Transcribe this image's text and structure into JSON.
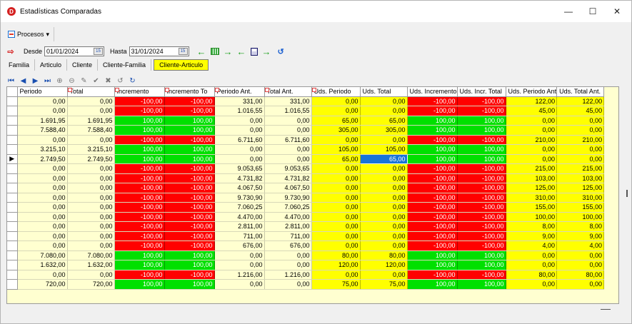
{
  "window": {
    "title": "Estadísticas Comparadas",
    "app_icon": "D",
    "min": "—",
    "max": "☐",
    "close": "✕"
  },
  "toolbar": {
    "procesos_label": "Procesos",
    "dropdown": "▾"
  },
  "filters": {
    "desde_label": "Desde",
    "desde_value": "01/01/2024",
    "hasta_label": "Hasta",
    "hasta_value": "31/01/2024",
    "cal": "15"
  },
  "tabs": [
    "Familia",
    "Articulo",
    "Cliente",
    "Cliente-Familia",
    "Cliente-Articulo"
  ],
  "navbar": [
    "◀",
    "◆",
    "▶",
    "▶",
    "⊕",
    "⊖",
    "✎",
    "✔",
    "✖",
    "↺",
    "↻"
  ],
  "columns": [
    "Periodo",
    "Total",
    "Incremento",
    "Incremento To",
    "Periodo Ant.",
    "Total Ant.",
    "Uds. Periodo",
    "Uds. Total",
    "Uds. Incremento",
    "Uds. Incr. Total",
    "Uds. Periodo Ant",
    "Uds. Total Ant."
  ],
  "rows": [
    [
      "0,00",
      "0,00",
      "-100,00",
      "-100,00",
      "331,00",
      "331,00",
      "0,00",
      "0,00",
      "-100,00",
      "-100,00",
      "122,00",
      "122,00"
    ],
    [
      "0,00",
      "0,00",
      "-100,00",
      "-100,00",
      "1.016,55",
      "1.016,55",
      "0,00",
      "0,00",
      "-100,00",
      "-100,00",
      "45,00",
      "45,00"
    ],
    [
      "1.691,95",
      "1.691,95",
      "100,00",
      "100,00",
      "0,00",
      "0,00",
      "65,00",
      "65,00",
      "100,00",
      "100,00",
      "0,00",
      "0,00"
    ],
    [
      "7.588,40",
      "7.588,40",
      "100,00",
      "100,00",
      "0,00",
      "0,00",
      "305,00",
      "305,00",
      "100,00",
      "100,00",
      "0,00",
      "0,00"
    ],
    [
      "0,00",
      "0,00",
      "-100,00",
      "-100,00",
      "6.711,60",
      "6.711,60",
      "0,00",
      "0,00",
      "-100,00",
      "-100,00",
      "210,00",
      "210,00"
    ],
    [
      "3.215,10",
      "3.215,10",
      "100,00",
      "100,00",
      "0,00",
      "0,00",
      "105,00",
      "105,00",
      "100,00",
      "100,00",
      "0,00",
      "0,00"
    ],
    [
      "2.749,50",
      "2.749,50",
      "100,00",
      "100,00",
      "0,00",
      "0,00",
      "65,00",
      "65,00",
      "100,00",
      "100,00",
      "0,00",
      "0,00"
    ],
    [
      "0,00",
      "0,00",
      "-100,00",
      "-100,00",
      "9.053,65",
      "9.053,65",
      "0,00",
      "0,00",
      "-100,00",
      "-100,00",
      "215,00",
      "215,00"
    ],
    [
      "0,00",
      "0,00",
      "-100,00",
      "-100,00",
      "4.731,82",
      "4.731,82",
      "0,00",
      "0,00",
      "-100,00",
      "-100,00",
      "103,00",
      "103,00"
    ],
    [
      "0,00",
      "0,00",
      "-100,00",
      "-100,00",
      "4.067,50",
      "4.067,50",
      "0,00",
      "0,00",
      "-100,00",
      "-100,00",
      "125,00",
      "125,00"
    ],
    [
      "0,00",
      "0,00",
      "-100,00",
      "-100,00",
      "9.730,90",
      "9.730,90",
      "0,00",
      "0,00",
      "-100,00",
      "-100,00",
      "310,00",
      "310,00"
    ],
    [
      "0,00",
      "0,00",
      "-100,00",
      "-100,00",
      "7.060,25",
      "7.060,25",
      "0,00",
      "0,00",
      "-100,00",
      "-100,00",
      "155,00",
      "155,00"
    ],
    [
      "0,00",
      "0,00",
      "-100,00",
      "-100,00",
      "4.470,00",
      "4.470,00",
      "0,00",
      "0,00",
      "-100,00",
      "-100,00",
      "100,00",
      "100,00"
    ],
    [
      "0,00",
      "0,00",
      "-100,00",
      "-100,00",
      "2.811,00",
      "2.811,00",
      "0,00",
      "0,00",
      "-100,00",
      "-100,00",
      "8,00",
      "8,00"
    ],
    [
      "0,00",
      "0,00",
      "-100,00",
      "-100,00",
      "711,00",
      "711,00",
      "0,00",
      "0,00",
      "-100,00",
      "-100,00",
      "9,00",
      "9,00"
    ],
    [
      "0,00",
      "0,00",
      "-100,00",
      "-100,00",
      "676,00",
      "676,00",
      "0,00",
      "0,00",
      "-100,00",
      "-100,00",
      "4,00",
      "4,00"
    ],
    [
      "7.080,00",
      "7.080,00",
      "100,00",
      "100,00",
      "0,00",
      "0,00",
      "80,00",
      "80,00",
      "100,00",
      "100,00",
      "0,00",
      "0,00"
    ],
    [
      "1.632,00",
      "1.632,00",
      "100,00",
      "100,00",
      "0,00",
      "0,00",
      "120,00",
      "120,00",
      "100,00",
      "100,00",
      "0,00",
      "0,00"
    ],
    [
      "0,00",
      "0,00",
      "-100,00",
      "-100,00",
      "1.216,00",
      "1.216,00",
      "0,00",
      "0,00",
      "-100,00",
      "-100,00",
      "80,00",
      "80,00"
    ],
    [
      "720,00",
      "720,00",
      "100,00",
      "100,00",
      "0,00",
      "0,00",
      "75,00",
      "75,00",
      "100,00",
      "100,00",
      "0,00",
      "0,00"
    ]
  ],
  "current_row": 6,
  "selected_col": 7,
  "colors": {
    "positive": "#00e000",
    "negative": "#ff0000",
    "uds": "#ffff00",
    "row_bg": "#ffffd0"
  }
}
